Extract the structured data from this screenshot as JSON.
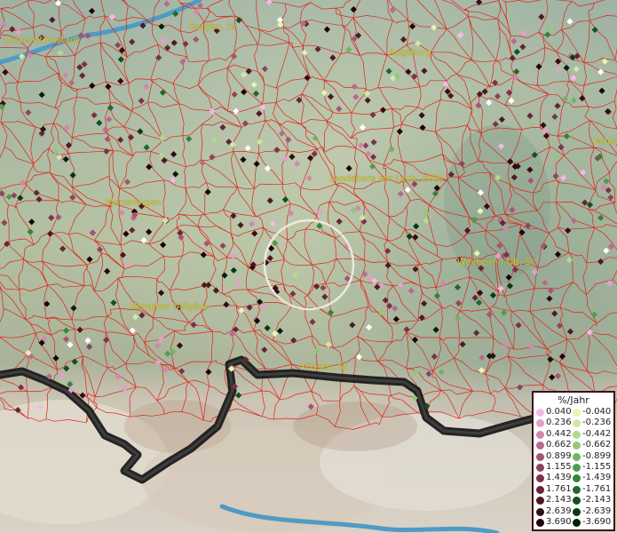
{
  "map": {
    "cities": [
      {
        "name": "Universitätsstadt"
      },
      {
        "name": "Burgau, St"
      },
      {
        "name": "Augsburg"
      },
      {
        "name": "Münch"
      },
      {
        "name": "Memmingen"
      },
      {
        "name": "Landsberg am Lech, GKSt"
      },
      {
        "name": "Weilheim i.OB, St"
      },
      {
        "name": "Kempten (Allgäu)"
      },
      {
        "name": "Füssen, St"
      }
    ]
  },
  "legend": {
    "title": "%/Jahr",
    "positive": [
      {
        "label": "0.040",
        "color": "#f5b8e6"
      },
      {
        "label": "0.236",
        "color": "#e59fc9"
      },
      {
        "label": "0.442",
        "color": "#d386ae"
      },
      {
        "label": "0.662",
        "color": "#b96b8d"
      },
      {
        "label": "0.899",
        "color": "#a35672"
      },
      {
        "label": "1.155",
        "color": "#8e445c"
      },
      {
        "label": "1.439",
        "color": "#7a3348"
      },
      {
        "label": "1.761",
        "color": "#642535"
      },
      {
        "label": "2.143",
        "color": "#4e1824"
      },
      {
        "label": "2.639",
        "color": "#360b15"
      },
      {
        "label": "3.690",
        "color": "#1d0309"
      }
    ],
    "negative": [
      {
        "label": "-0.040",
        "color": "#e8f4b0"
      },
      {
        "label": "-0.236",
        "color": "#cfe9a2"
      },
      {
        "label": "-0.442",
        "color": "#b2da8f"
      },
      {
        "label": "-0.662",
        "color": "#93c87a"
      },
      {
        "label": "-0.899",
        "color": "#73b364"
      },
      {
        "label": "-1.155",
        "color": "#529c4b"
      },
      {
        "label": "-1.439",
        "color": "#36833a"
      },
      {
        "label": "-1.761",
        "color": "#1f6a2a"
      },
      {
        "label": "-2.143",
        "color": "#10511e"
      },
      {
        "label": "-2.639",
        "color": "#063913"
      },
      {
        "label": "-3.690",
        "color": "#01200a"
      }
    ]
  },
  "colors": {
    "border_red": "#e0241c",
    "alps_line": "#111111",
    "river": "#4f9bc4",
    "selection_ring": "#f4f1ea"
  }
}
